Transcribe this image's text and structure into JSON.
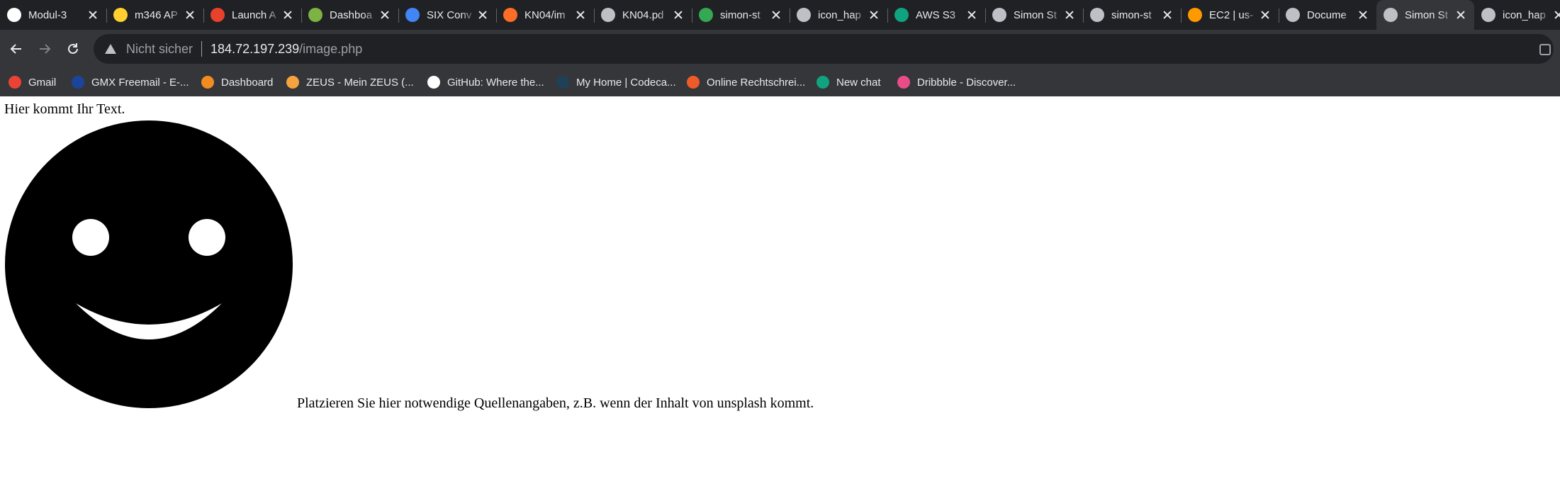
{
  "tabs": [
    {
      "title": "Modul-3",
      "icon": "github-icon",
      "color": "#ffffff"
    },
    {
      "title": "m346 AP",
      "icon": "miro-icon",
      "color": "#ffd02f"
    },
    {
      "title": "Launch A",
      "icon": "launch-icon",
      "color": "#e8412c"
    },
    {
      "title": "Dashboa",
      "icon": "key-icon",
      "color": "#7cb342"
    },
    {
      "title": "SIX Conv",
      "icon": "map-pin-icon",
      "color": "#4285f4"
    },
    {
      "title": "KN04/im",
      "icon": "gitlab-icon",
      "color": "#fc6d26"
    },
    {
      "title": "KN04.pd",
      "icon": "globe-icon",
      "color": "#bdc1c6"
    },
    {
      "title": "simon-st",
      "icon": "terminal-icon",
      "color": "#34a853"
    },
    {
      "title": "icon_hap",
      "icon": "globe-icon",
      "color": "#bdc1c6"
    },
    {
      "title": "AWS S3",
      "icon": "chatgpt-icon",
      "color": "#10a37f"
    },
    {
      "title": "Simon St",
      "icon": "globe-icon",
      "color": "#bdc1c6"
    },
    {
      "title": "simon-st",
      "icon": "globe-icon",
      "color": "#bdc1c6"
    },
    {
      "title": "EC2 | us-",
      "icon": "aws-icon",
      "color": "#ff9900"
    },
    {
      "title": "Docume",
      "icon": "globe-icon",
      "color": "#bdc1c6"
    },
    {
      "title": "Simon St",
      "icon": "globe-icon",
      "color": "#bdc1c6",
      "active": true
    },
    {
      "title": "icon_hap",
      "icon": "globe-icon",
      "color": "#bdc1c6"
    }
  ],
  "omnibox": {
    "security_label": "Nicht sicher",
    "host": "184.72.197.239",
    "path": "/image.php"
  },
  "bookmarks": [
    {
      "label": "Gmail",
      "icon": "gmail-icon",
      "color": "#ea4335"
    },
    {
      "label": "GMX Freemail - E-...",
      "icon": "gmx-icon",
      "color": "#1c449b"
    },
    {
      "label": "Dashboard",
      "icon": "dashboard-icon",
      "color": "#f28b20"
    },
    {
      "label": "ZEUS - Mein ZEUS (...",
      "icon": "zeus-icon",
      "color": "#f4a340"
    },
    {
      "label": "GitHub: Where the...",
      "icon": "github-icon",
      "color": "#ffffff"
    },
    {
      "label": "My Home | Codeca...",
      "icon": "codecademy-icon",
      "color": "#1f4056"
    },
    {
      "label": "Online Rechtschrei...",
      "icon": "duden-icon",
      "color": "#f05a28"
    },
    {
      "label": "New chat",
      "icon": "chatgpt-icon",
      "color": "#10a37f"
    },
    {
      "label": "Dribbble - Discover...",
      "icon": "dribbble-icon",
      "color": "#ea4c89"
    }
  ],
  "page": {
    "text": "Hier kommt Ihr Text.",
    "credit": "Platzieren Sie hier notwendige Quellenangaben, z.B. wenn der Inhalt von unsplash kommt."
  }
}
